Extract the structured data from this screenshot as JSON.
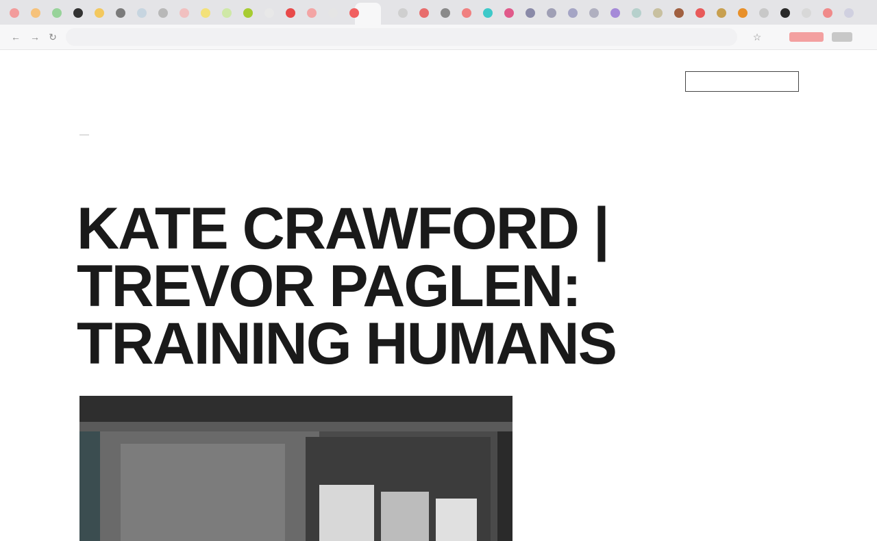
{
  "browser": {
    "tab_favicon_colors": [
      "#f29c9c",
      "#f6c27b",
      "#98d39a",
      "#333333",
      "#f3c85e",
      "#7b7b7b",
      "#c7d5e0",
      "#b8b8b8",
      "#f1c0c0",
      "#f3e17a",
      "#cfe8a7",
      "#a7cc32",
      "#e8e8e8",
      "#e84a4a",
      "#f3a5a5",
      "#e5e5e5",
      "#f16060",
      "#cfcfcf",
      "#e86d6d",
      "#8a8a8a",
      "#f08080",
      "#3ec9c9",
      "#e05a8a",
      "#8a8aa8",
      "#9f9fb5",
      "#a5a5c5",
      "#b0b0c0",
      "#a58ad8",
      "#b6d0cc",
      "#c8c0a0",
      "#a06040",
      "#e85a5a",
      "#c8a050",
      "#e8902a",
      "#c8c8c8",
      "#2a2a2a",
      "#d8d8d8",
      "#f08a8a",
      "#d0d0e0"
    ],
    "address": "",
    "icons": [
      "back-icon",
      "forward-icon",
      "reload-icon",
      "star-icon",
      "extension-icon",
      "profile-icon"
    ]
  },
  "site": {
    "brand": "",
    "nav_items": [
      "",
      "",
      "",
      "",
      "",
      "",
      "",
      ""
    ],
    "subscribe_label": ""
  },
  "article": {
    "kicker": "",
    "title_line1": "KATE CRAWFORD |",
    "title_line2": "TREVOR PAGLEN:",
    "title_line3": "TRAINING HUMANS"
  },
  "colors": {
    "tabstrip": "#e4e4e7",
    "toolbar": "#f7f7f8",
    "title_text": "#1a1a1a"
  }
}
